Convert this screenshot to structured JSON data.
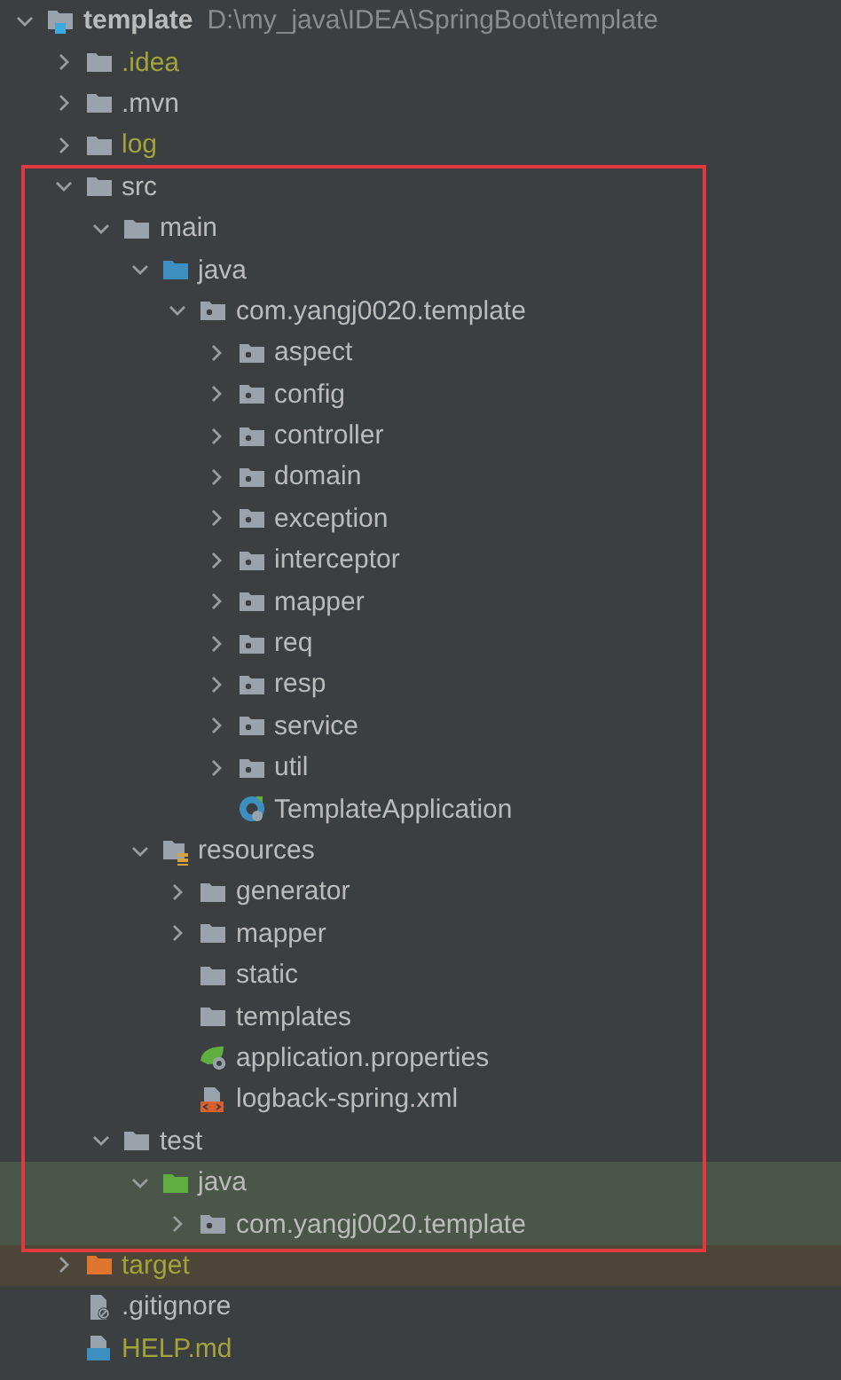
{
  "project_tree": [
    {
      "label": "template",
      "path": "D:\\my_java\\IDEA\\SpringBoot\\template",
      "kind": "module",
      "expanded": true,
      "children": [
        {
          "label": ".idea",
          "kind": "ignored-folder",
          "expanded": false
        },
        {
          "label": ".mvn",
          "kind": "folder",
          "expanded": false
        },
        {
          "label": "log",
          "kind": "ignored-folder",
          "expanded": false
        },
        {
          "label": "src",
          "kind": "folder",
          "expanded": true,
          "highlighted": true,
          "children": [
            {
              "label": "main",
              "kind": "folder",
              "expanded": true,
              "children": [
                {
                  "label": "java",
                  "kind": "source",
                  "expanded": true,
                  "children": [
                    {
                      "label": "com.yangj0020.template",
                      "kind": "package",
                      "expanded": true,
                      "children": [
                        {
                          "label": "aspect",
                          "kind": "package",
                          "expanded": false
                        },
                        {
                          "label": "config",
                          "kind": "package",
                          "expanded": false
                        },
                        {
                          "label": "controller",
                          "kind": "package",
                          "expanded": false
                        },
                        {
                          "label": "domain",
                          "kind": "package",
                          "expanded": false
                        },
                        {
                          "label": "exception",
                          "kind": "package",
                          "expanded": false
                        },
                        {
                          "label": "interceptor",
                          "kind": "package",
                          "expanded": false
                        },
                        {
                          "label": "mapper",
                          "kind": "package",
                          "expanded": false
                        },
                        {
                          "label": "req",
                          "kind": "package",
                          "expanded": false
                        },
                        {
                          "label": "resp",
                          "kind": "package",
                          "expanded": false
                        },
                        {
                          "label": "service",
                          "kind": "package",
                          "expanded": false
                        },
                        {
                          "label": "util",
                          "kind": "package",
                          "expanded": false
                        },
                        {
                          "label": "TemplateApplication",
                          "kind": "class"
                        }
                      ]
                    }
                  ]
                },
                {
                  "label": "resources",
                  "kind": "resources",
                  "expanded": true,
                  "children": [
                    {
                      "label": "generator",
                      "kind": "folder",
                      "expanded": false
                    },
                    {
                      "label": "mapper",
                      "kind": "folder",
                      "expanded": false
                    },
                    {
                      "label": "static",
                      "kind": "folder"
                    },
                    {
                      "label": "templates",
                      "kind": "folder"
                    },
                    {
                      "label": "application.properties",
                      "kind": "properties"
                    },
                    {
                      "label": "logback-spring.xml",
                      "kind": "xml"
                    }
                  ]
                }
              ]
            },
            {
              "label": "test",
              "kind": "folder",
              "expanded": true,
              "children": [
                {
                  "label": "java",
                  "kind": "test-source",
                  "expanded": true,
                  "children": [
                    {
                      "label": "com.yangj0020.template",
                      "kind": "test-package",
                      "expanded": false
                    }
                  ]
                }
              ]
            }
          ]
        },
        {
          "label": "target",
          "kind": "excluded-folder",
          "expanded": false
        },
        {
          "label": ".gitignore",
          "kind": "gitignore"
        },
        {
          "label": "HELP.md",
          "kind": "ignored-markdown"
        }
      ]
    }
  ]
}
